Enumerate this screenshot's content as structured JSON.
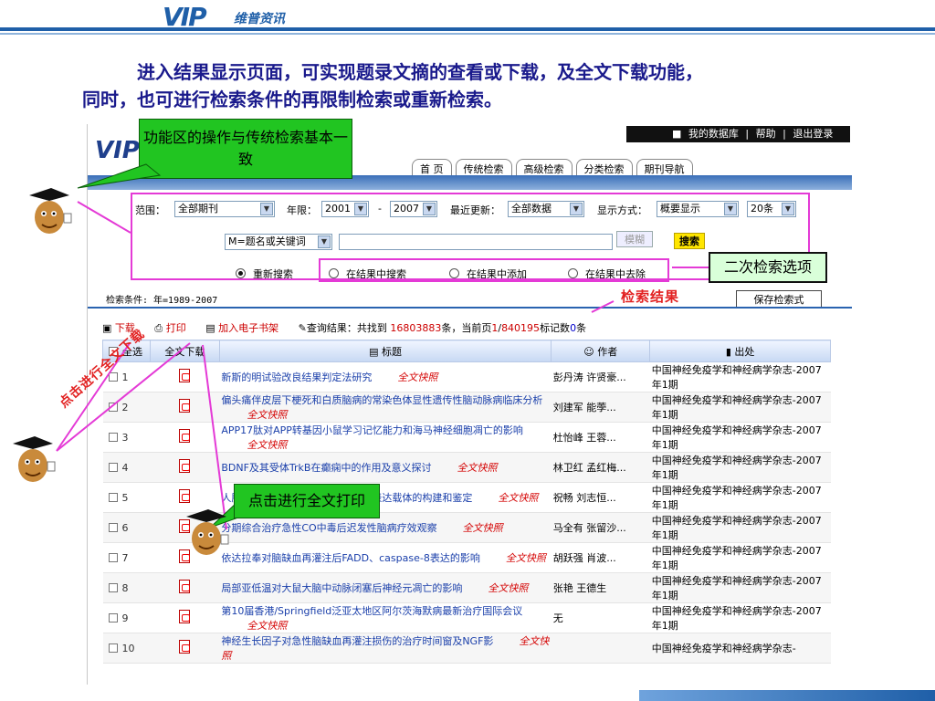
{
  "logo": {
    "vip": "VIP",
    "cn": "维普资讯"
  },
  "intro": {
    "line1": "进入结果显示页面，可实现题录文摘的查看或下载，及全文下载功能，",
    "line2": "同时，也可进行检索条件的再限制检索或重新检索。"
  },
  "user_bar": {
    "my_db": "我的数据库",
    "help": "帮助",
    "logout": "退出登录",
    "sep": "|"
  },
  "nav_tabs": [
    "首 页",
    "传统检索",
    "高级检索",
    "分类检索",
    "期刊导航"
  ],
  "search": {
    "range_label": "范围：",
    "range_value": "全部期刊",
    "year_label": "年限：",
    "year_from": "2001",
    "dash": "-",
    "year_to": "2007",
    "update_label": "最近更新：",
    "update_value": "全部数据",
    "display_label": "显示方式：",
    "display_value": "概要显示",
    "count_value": "20条",
    "field_value": "M=题名或关键词",
    "keyword_value": "",
    "fuzzy": "模糊",
    "search_btn": "搜索",
    "radios": [
      {
        "label": "重新搜索",
        "checked": true
      },
      {
        "label": "在结果中搜索",
        "checked": false
      },
      {
        "label": "在结果中添加",
        "checked": false
      },
      {
        "label": "在结果中去除",
        "checked": false
      }
    ]
  },
  "condition": "检索条件: 年=1989-2007",
  "save_btn": "保存检索式",
  "toolbar": {
    "download": "下载",
    "print": "打印",
    "add_shelf": "加入电子书架",
    "result_prefix": "查询结果：共找到 ",
    "total": "16803883",
    "result_mid": "条，当前页",
    "page": "1",
    "page_sep": "/",
    "pages": "840195",
    "marked_prefix": "标记数",
    "marked": "0",
    "marked_suffix": "条"
  },
  "table": {
    "headers": {
      "select_all": "全选",
      "fulltext": "全文下载",
      "title": "标题",
      "author": "作者",
      "source": "出处"
    },
    "fulltext_tag": "全文快照",
    "rows": [
      {
        "n": "1",
        "title": "新斯的明试验改良结果判定法研究",
        "author": "彭丹涛 许贤豪...",
        "source": "中国神经免疫学和神经病学杂志-2007年1期"
      },
      {
        "n": "2",
        "title": "偏头痛伴皮层下梗死和白质脑病的常染色体显性遗传性脑动脉病临床分析",
        "author": "刘建军 能荸...",
        "source": "中国神经免疫学和神经病学杂志-2007年1期"
      },
      {
        "n": "3",
        "title": "APP17肽对APP转基因小鼠学习记忆能力和海马神经细胞凋亡的影响",
        "author": "杜怡峰 王蓉...",
        "source": "中国神经免疫学和神经病学杂志-2007年1期"
      },
      {
        "n": "4",
        "title": "BDNF及其受体TrkB在癫痫中的作用及意义探讨",
        "author": "林卫红 孟红梅...",
        "source": "中国神经免疫学和神经病学杂志-2007年1期"
      },
      {
        "n": "5",
        "title": "人肌萎缩侧索硬化症相关基因真核表达载体的构建和鉴定",
        "author": "祝畅 刘志恒...",
        "source": "中国神经免疫学和神经病学杂志-2007年1期"
      },
      {
        "n": "6",
        "title": "分期综合治疗急性CO中毒后迟发性脑病疗效观察",
        "author": "马全有 张留沙...",
        "source": "中国神经免疫学和神经病学杂志-2007年1期"
      },
      {
        "n": "7",
        "title": "依达拉奉对脑缺血再灌注后FADD、caspase-8表达的影响",
        "author": "胡跃强 肖波...",
        "source": "中国神经免疫学和神经病学杂志-2007年1期"
      },
      {
        "n": "8",
        "title": "局部亚低温对大鼠大脑中动脉闭塞后神经元凋亡的影响",
        "author": "张艳 王德生",
        "source": "中国神经免疫学和神经病学杂志-2007年1期"
      },
      {
        "n": "9",
        "title": "第10届香港/Springfield泛亚太地区阿尔茨海默病最新治疗国际会议",
        "author": "无",
        "source": "中国神经免疫学和神经病学杂志-2007年1期"
      },
      {
        "n": "10",
        "title": "神经生长因子对急性脑缺血再灌注损伤的治疗时间窗及NGF影",
        "author": "",
        "source": "中国神经免疫学和神经病学杂志-"
      }
    ]
  },
  "annotations": {
    "callout_func": "功能区的操作与传统检索基本一致",
    "label_secondary": "二次检索选项",
    "label_results": "检索结果",
    "diag_text": "点击进行全文下载",
    "callout_print": "点击进行全文打印"
  },
  "colors": {
    "accent": "#1f5fa8",
    "annotation": "#e43ad6",
    "callout": "#21c521",
    "highlight": "#cc0000"
  }
}
